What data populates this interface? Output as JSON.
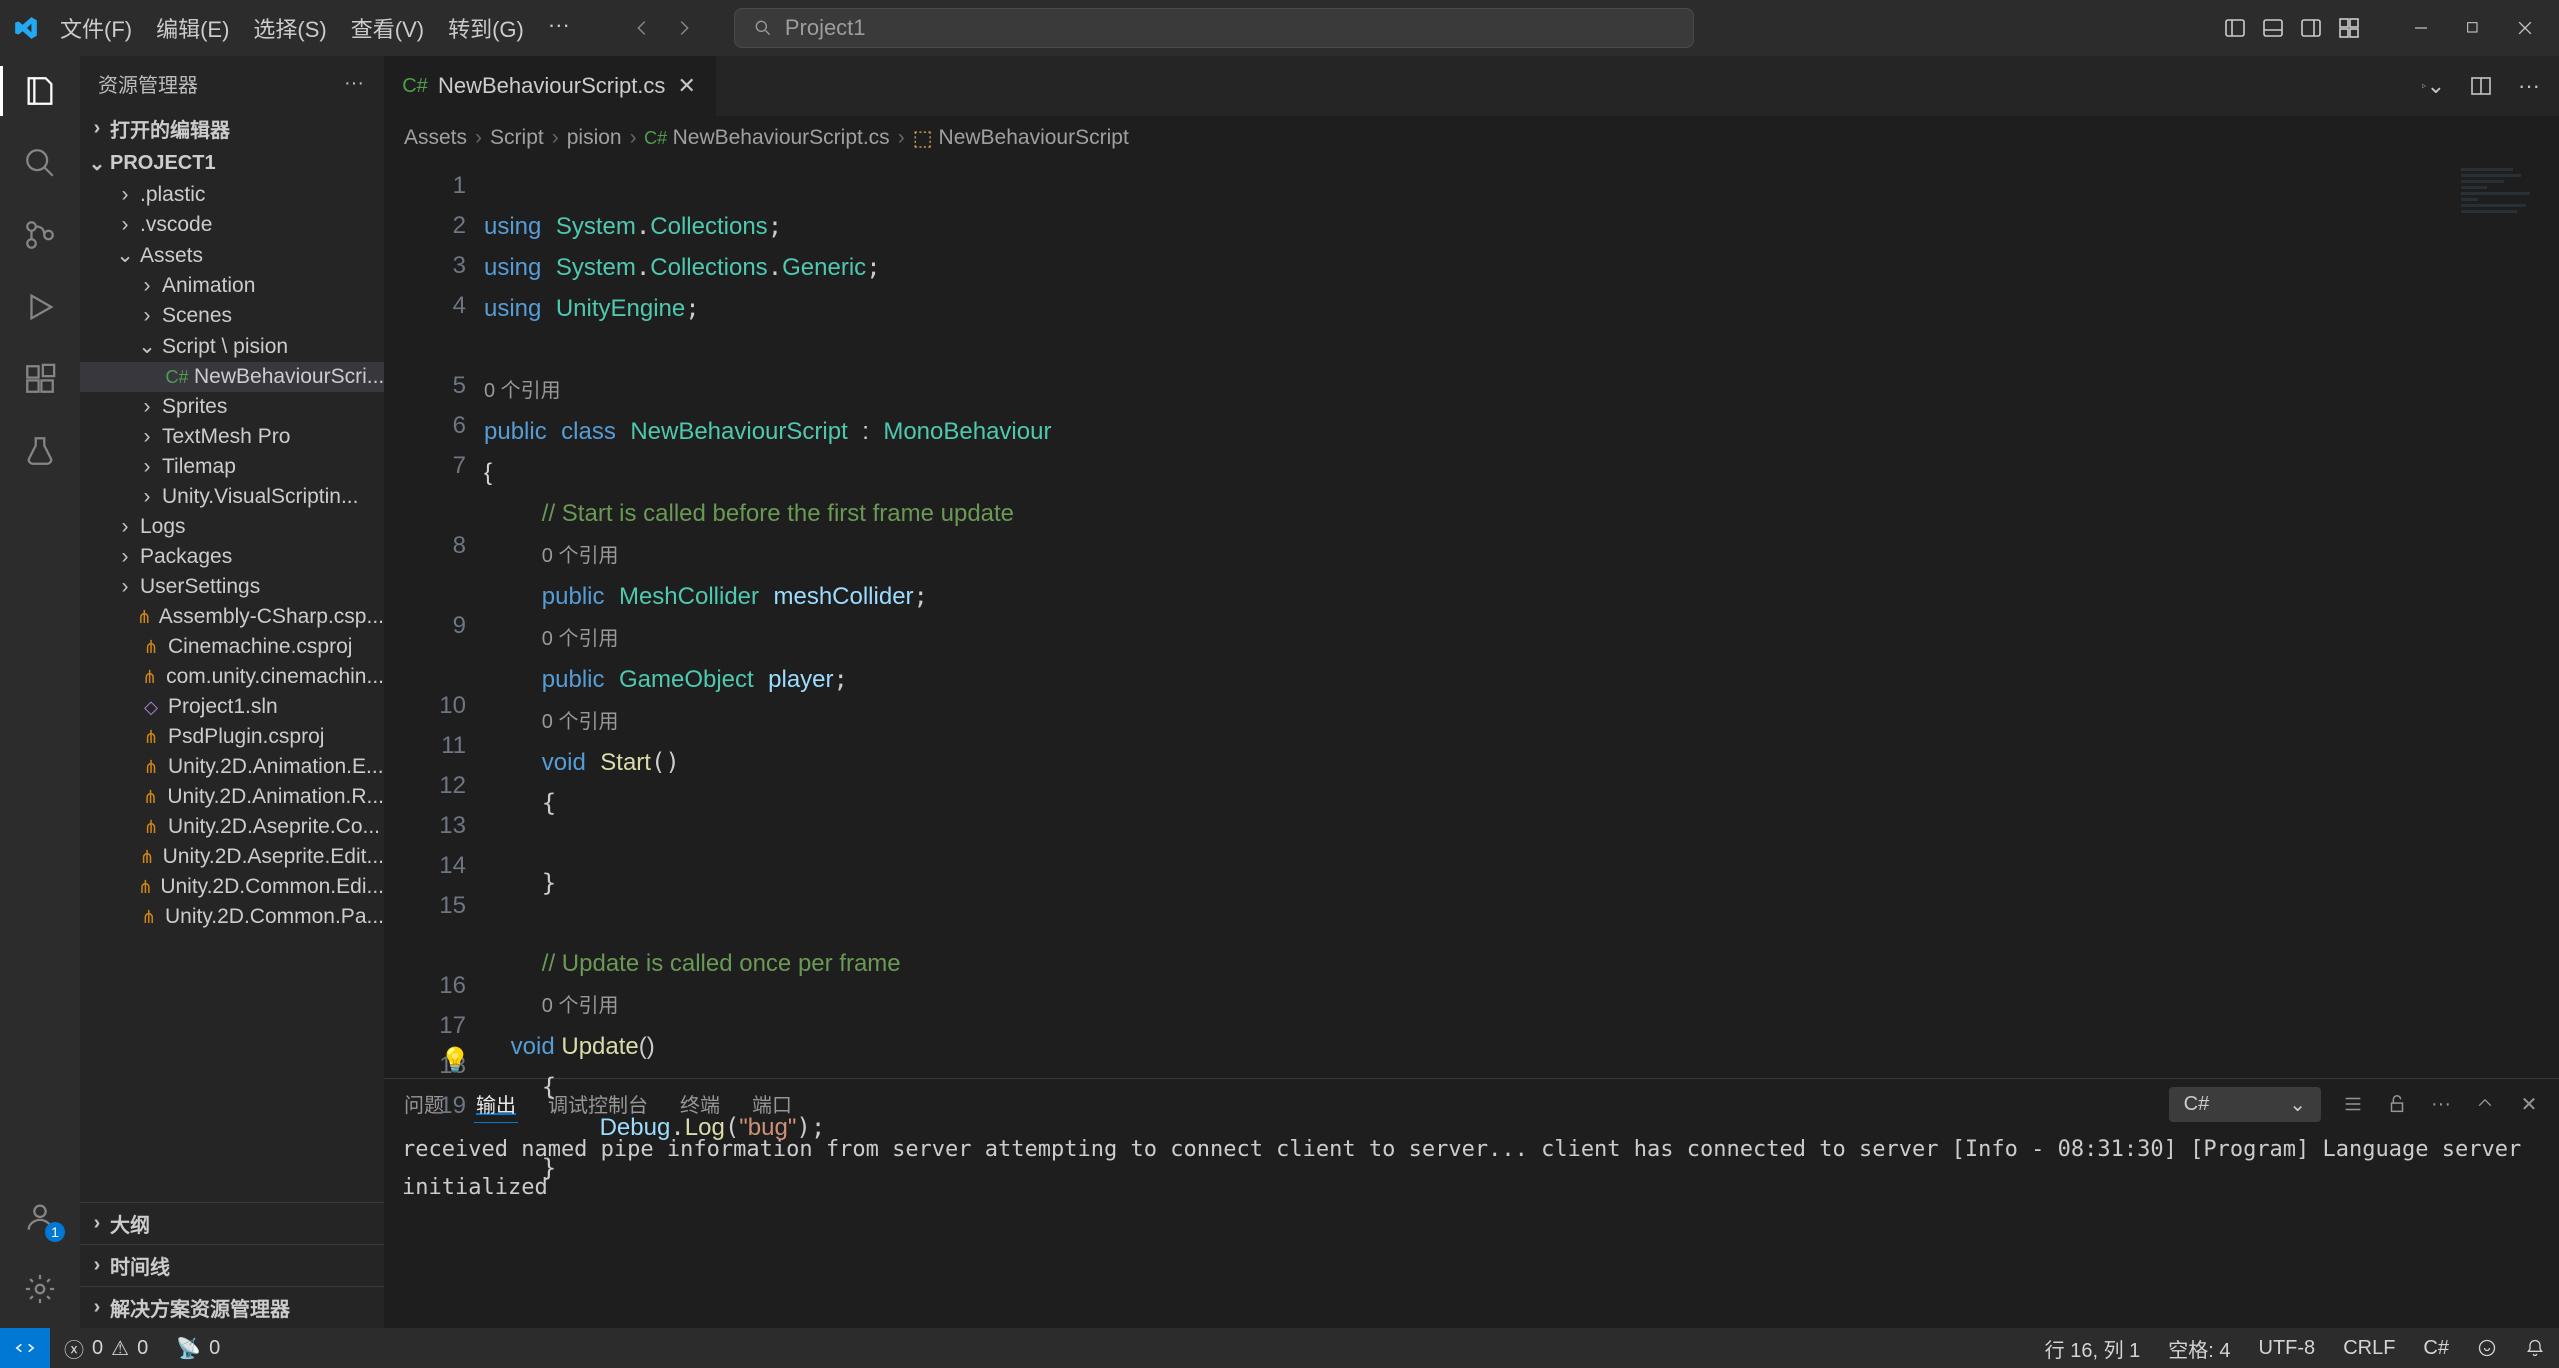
{
  "titlebar": {
    "menu": [
      "文件(F)",
      "编辑(E)",
      "选择(S)",
      "查看(V)",
      "转到(G)",
      "···"
    ],
    "search_placeholder": "Project1"
  },
  "sidebar": {
    "title": "资源管理器",
    "sections": {
      "open_editors": "打开的编辑器",
      "project": "PROJECT1",
      "outline": "大纲",
      "timeline": "时间线",
      "solution": "解决方案资源管理器"
    },
    "tree": [
      {
        "d": 1,
        "chev": ">",
        "icon": "",
        "label": ".plastic"
      },
      {
        "d": 1,
        "chev": ">",
        "icon": "",
        "label": ".vscode"
      },
      {
        "d": 1,
        "chev": "v",
        "icon": "",
        "label": "Assets"
      },
      {
        "d": 2,
        "chev": ">",
        "icon": "",
        "label": "Animation"
      },
      {
        "d": 2,
        "chev": ">",
        "icon": "",
        "label": "Scenes"
      },
      {
        "d": 2,
        "chev": "v",
        "icon": "",
        "label": "Script \\ pision"
      },
      {
        "d": 3,
        "chev": "",
        "icon": "cs",
        "label": "NewBehaviourScri...",
        "sel": true
      },
      {
        "d": 2,
        "chev": ">",
        "icon": "",
        "label": "Sprites"
      },
      {
        "d": 2,
        "chev": ">",
        "icon": "",
        "label": "TextMesh Pro"
      },
      {
        "d": 2,
        "chev": ">",
        "icon": "",
        "label": "Tilemap"
      },
      {
        "d": 2,
        "chev": ">",
        "icon": "",
        "label": "Unity.VisualScriptin..."
      },
      {
        "d": 1,
        "chev": ">",
        "icon": "",
        "label": "Logs"
      },
      {
        "d": 1,
        "chev": ">",
        "icon": "",
        "label": "Packages"
      },
      {
        "d": 1,
        "chev": ">",
        "icon": "",
        "label": "UserSettings"
      },
      {
        "d": 1,
        "chev": "",
        "icon": "rss",
        "label": "Assembly-CSharp.csp..."
      },
      {
        "d": 1,
        "chev": "",
        "icon": "rss",
        "label": "Cinemachine.csproj"
      },
      {
        "d": 1,
        "chev": "",
        "icon": "rss",
        "label": "com.unity.cinemachin..."
      },
      {
        "d": 1,
        "chev": "",
        "icon": "sln",
        "label": "Project1.sln"
      },
      {
        "d": 1,
        "chev": "",
        "icon": "rss",
        "label": "PsdPlugin.csproj"
      },
      {
        "d": 1,
        "chev": "",
        "icon": "rss",
        "label": "Unity.2D.Animation.E..."
      },
      {
        "d": 1,
        "chev": "",
        "icon": "rss",
        "label": "Unity.2D.Animation.R..."
      },
      {
        "d": 1,
        "chev": "",
        "icon": "rss",
        "label": "Unity.2D.Aseprite.Co..."
      },
      {
        "d": 1,
        "chev": "",
        "icon": "rss",
        "label": "Unity.2D.Aseprite.Edit..."
      },
      {
        "d": 1,
        "chev": "",
        "icon": "rss",
        "label": "Unity.2D.Common.Edi..."
      },
      {
        "d": 1,
        "chev": "",
        "icon": "rss",
        "label": "Unity.2D.Common.Pa..."
      }
    ]
  },
  "tab": {
    "label": "NewBehaviourScript.cs"
  },
  "breadcrumbs": [
    "Assets",
    "Script",
    "pision",
    "NewBehaviourScript.cs",
    "NewBehaviourScript"
  ],
  "codelens": "0 个引用",
  "panel": {
    "tabs": [
      "问题",
      "输出",
      "调试控制台",
      "终端",
      "端口"
    ],
    "active": 1,
    "filter": "C#",
    "lines": [
      "received named pipe information from server",
      "attempting to connect client to server...",
      "client has connected to server",
      "[Info  - 08:31:30] [Program] Language server initialized"
    ]
  },
  "statusbar": {
    "errors": "0",
    "warnings": "0",
    "ports": "0",
    "ln_col": "行 16, 列 1",
    "spaces": "空格: 4",
    "encoding": "UTF-8",
    "eol": "CRLF",
    "lang": "C#"
  },
  "accounts_badge": "1"
}
